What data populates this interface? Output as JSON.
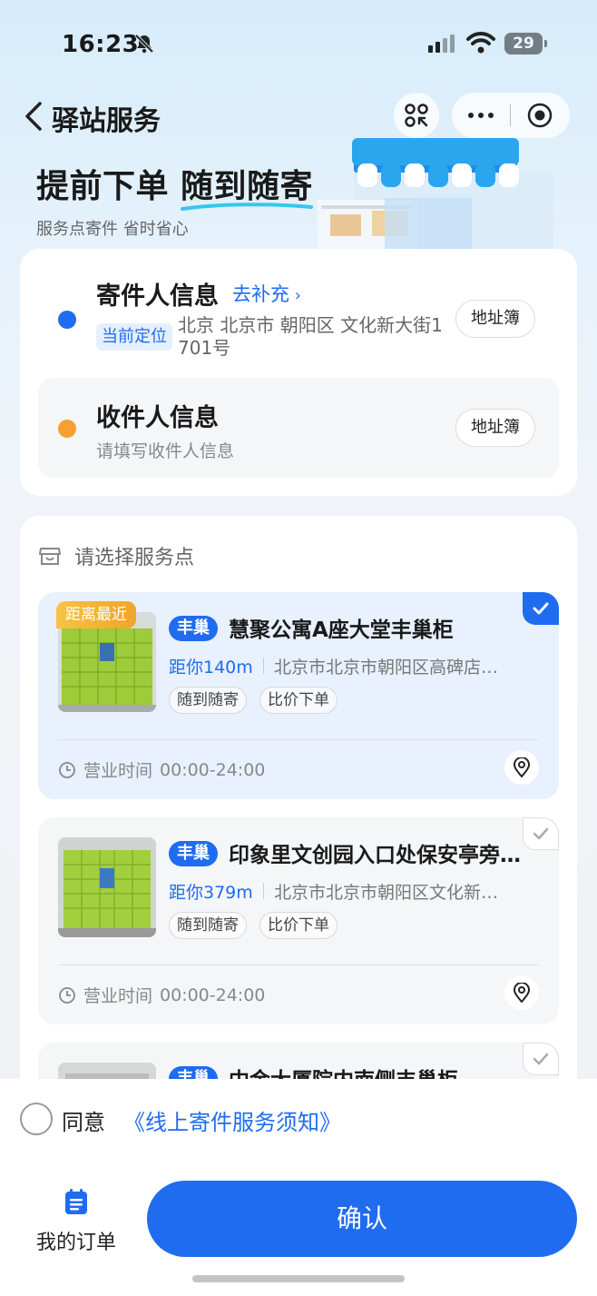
{
  "status_bar": {
    "time": "16:23",
    "battery": "29"
  },
  "nav": {
    "title": "驿站服务"
  },
  "hero": {
    "title_plain": "提前下单 ",
    "title_highlight": "随到随寄",
    "subtitle": "服务点寄件 省时省心"
  },
  "sender": {
    "title": "寄件人信息",
    "link": "去补充",
    "location_tag": "当前定位",
    "address": "北京 北京市 朝阳区 文化新大街1701号",
    "book_label": "地址簿"
  },
  "receiver": {
    "title": "收件人信息",
    "placeholder": "请填写收件人信息",
    "book_label": "地址簿"
  },
  "service_points": {
    "header": "请选择服务点",
    "nearest_badge": "距离最近",
    "hours_label": "营业时间",
    "items": [
      {
        "brand": "丰巢",
        "name": "慧聚公寓A座大堂丰巢柜",
        "distance": "距你140m",
        "address": "北京市北京市朝阳区高碑店…",
        "tags": [
          "随到随寄",
          "比价下单"
        ],
        "hours": "00:00-24:00",
        "selected": true
      },
      {
        "brand": "丰巢",
        "name": "印象里文创园入口处保安亭旁…",
        "distance": "距你379m",
        "address": "北京市北京市朝阳区文化新…",
        "tags": [
          "随到随寄",
          "比价下单"
        ],
        "hours": "00:00-24:00",
        "selected": false
      },
      {
        "brand": "丰巢",
        "name": "中金大厦院内南侧丰巢柜",
        "selected": false
      }
    ]
  },
  "footer": {
    "agree_label": "同意",
    "agree_link": "《线上寄件服务须知》",
    "orders_label": "我的订单",
    "confirm_label": "确认"
  },
  "colors": {
    "primary": "#1f6cf0",
    "sender_dot": "#1f6cf0",
    "receiver_dot": "#f7a032",
    "badge": "#f0a52a"
  }
}
